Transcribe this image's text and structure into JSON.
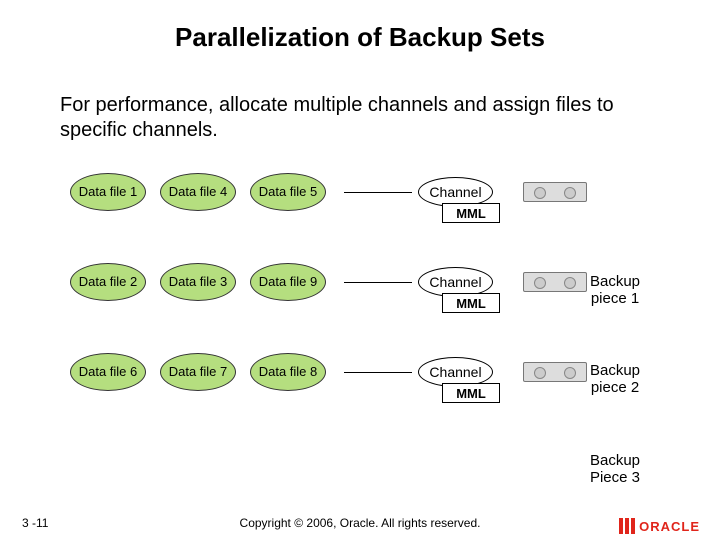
{
  "title": "Parallelization of Backup Sets",
  "description": "For performance, allocate multiple channels and assign files to specific channels.",
  "rows": [
    {
      "files": [
        "Data file 1",
        "Data file 4",
        "Data file 5"
      ],
      "channel": "Channel",
      "mml": "MML",
      "piece": "Backup piece 1"
    },
    {
      "files": [
        "Data file 2",
        "Data file 3",
        "Data file 9"
      ],
      "channel": "Channel",
      "mml": "MML",
      "piece": "Backup piece 2"
    },
    {
      "files": [
        "Data file 6",
        "Data file 7",
        "Data file 8"
      ],
      "channel": "Channel",
      "mml": "MML",
      "piece": "Backup Piece 3"
    }
  ],
  "page_number": "3 -11",
  "copyright": "Copyright © 2006, Oracle. All rights reserved.",
  "logo": "ORACLE"
}
